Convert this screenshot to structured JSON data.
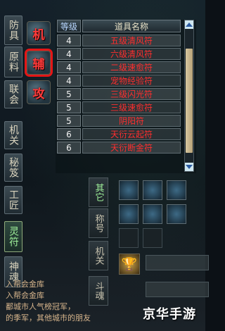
{
  "left_tabs": [
    {
      "label": "防具",
      "active": false
    },
    {
      "label": "原料",
      "active": false
    },
    {
      "label": "联会",
      "active": false
    },
    {
      "label": "机关",
      "active": false
    },
    {
      "label": "秘笈",
      "active": false
    },
    {
      "label": "工匠",
      "active": false
    },
    {
      "label": "灵符",
      "active": true
    },
    {
      "label": "神魂",
      "active": false
    }
  ],
  "item_icons": [
    {
      "glyph": "机",
      "name": "icon-ji",
      "selected": false
    },
    {
      "glyph": "辅",
      "name": "icon-fu",
      "selected": true
    },
    {
      "glyph": "攻",
      "name": "icon-gong",
      "selected": false
    }
  ],
  "table": {
    "header_level": "等级",
    "header_name": "道具名称",
    "rows": [
      {
        "level": "4",
        "name": "五级清风符"
      },
      {
        "level": "4",
        "name": "六级清风符"
      },
      {
        "level": "4",
        "name": "二级速愈符"
      },
      {
        "level": "4",
        "name": "宠物经验符"
      },
      {
        "level": "5",
        "name": "三级闪光符"
      },
      {
        "level": "5",
        "name": "三级速愈符"
      },
      {
        "level": "5",
        "name": "阴阳符"
      },
      {
        "level": "6",
        "name": "天衍云起符"
      },
      {
        "level": "6",
        "name": "天衍断金符"
      }
    ]
  },
  "lower_tabs": [
    {
      "label": "其它",
      "active": true
    },
    {
      "label": "称号",
      "active": false
    },
    {
      "label": "机关",
      "active": false
    },
    {
      "label": "斗魂",
      "active": false
    }
  ],
  "chat": {
    "line1": "入帮会金库",
    "line2": "入帮会金库",
    "line3": "鄱城市人气榜冠军，",
    "line4": "的季军，其他城市的朋友"
  },
  "watermark": "京华手游",
  "colors": {
    "item_text": "#ff2e2e",
    "level_header": "#b8d7ff",
    "active_tab": "#9ff09a",
    "selection_highlight": "#e41616"
  }
}
